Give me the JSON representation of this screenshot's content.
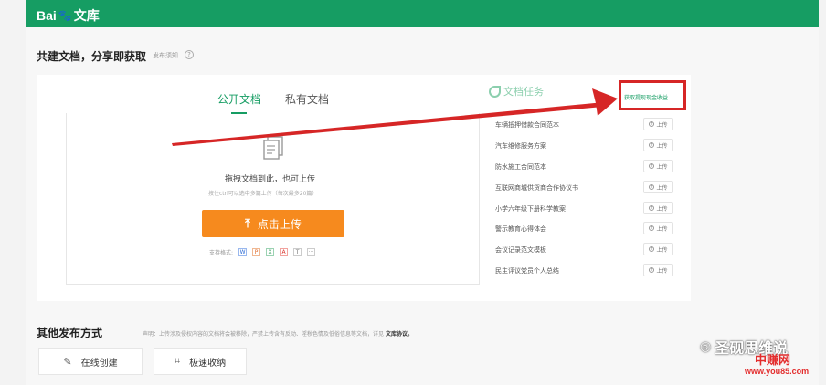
{
  "header": {
    "logo_text": "Bai",
    "logo_suffix": "文库",
    "brand_color": "#169d63"
  },
  "section": {
    "title": "共建文档，分享即获取",
    "notice": "发布须知"
  },
  "tabs": [
    {
      "label": "公开文档",
      "active": true
    },
    {
      "label": "私有文档",
      "active": false
    }
  ],
  "upload": {
    "hint": "拖拽文档到此，也可上传",
    "sub_hint": "按住ctrl可以选中多篇上传（每次最多20篇）",
    "button_label": "点击上传",
    "button_color": "#f68a1e",
    "formats_label": "支持格式:",
    "formats": [
      "W",
      "P",
      "X",
      "A",
      "T",
      "···"
    ]
  },
  "tasks": {
    "title": "文档任务",
    "cash_link": "获取提现现金收益",
    "upload_label": "上传",
    "items": [
      "车辆抵押借款合同范本",
      "汽车维修服务方案",
      "防水施工合同范本",
      "互联网商城供货商合作协议书",
      "小学六年级下册科学教案",
      "警示教育心得体会",
      "会议记录范文模板",
      "民主评议党员个人总结"
    ]
  },
  "other": {
    "title": "其他发布方式",
    "disclaimer": "声明：上传涉及侵权内容的文档将会被移除，严禁上传含有反动、淫秽色情及低俗信息等文档，详见",
    "agreement": "文库协议。",
    "online_label": "在线创建",
    "collect_label": "极速收纳"
  },
  "watermark": {
    "brand": "圣砚思维说",
    "site_cn": "中赚网",
    "site_url": "www.you85.com"
  },
  "annotation": {
    "color": "#d62626"
  }
}
